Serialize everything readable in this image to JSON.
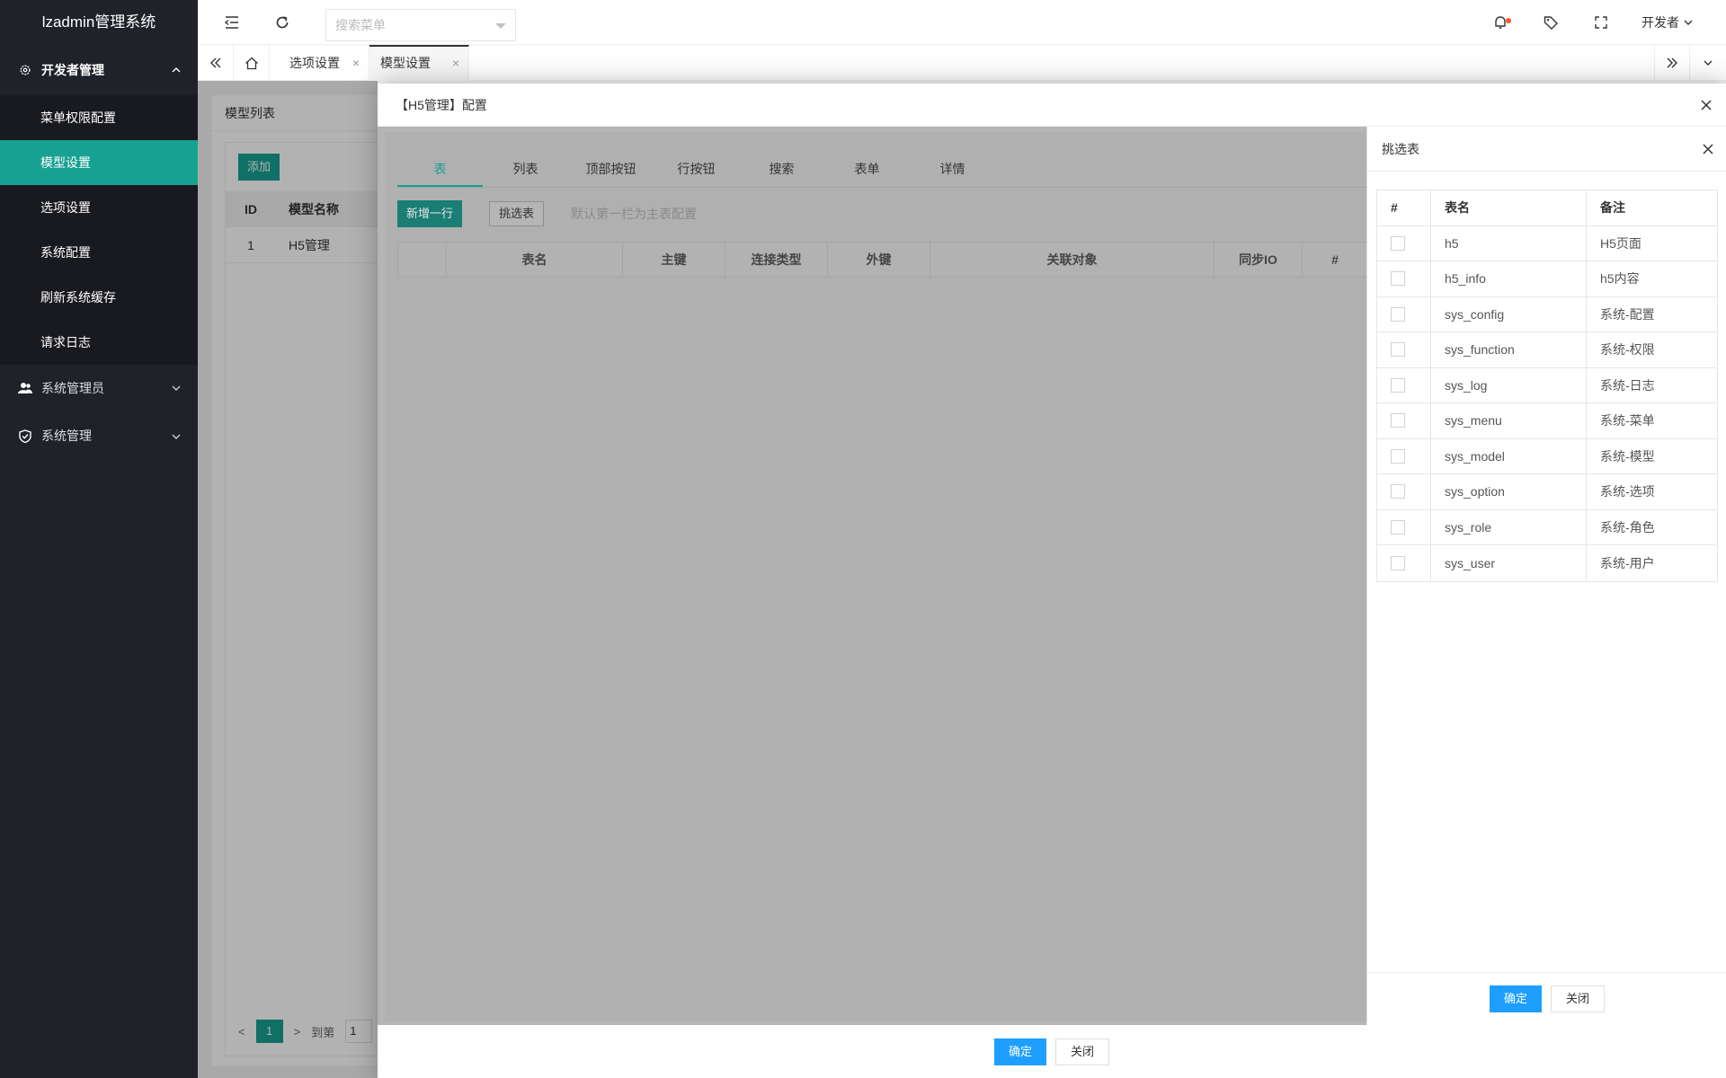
{
  "app": {
    "title": "lzadmin管理系统"
  },
  "sidebar": {
    "groups": [
      {
        "label": "开发者管理",
        "icon": "gear-icon",
        "expanded": true,
        "items": [
          "菜单权限配置",
          "模型设置",
          "选项设置",
          "系统配置",
          "刷新系统缓存",
          "请求日志"
        ],
        "active_item": "模型设置"
      },
      {
        "label": "系统管理员",
        "icon": "users-icon",
        "expanded": false
      },
      {
        "label": "系统管理",
        "icon": "shield-icon",
        "expanded": false
      }
    ]
  },
  "header": {
    "search_placeholder": "搜索菜单",
    "user": "开发者"
  },
  "tabs": [
    {
      "label": "选项设置"
    },
    {
      "label": "模型设置"
    }
  ],
  "page": {
    "card_title": "模型列表",
    "add_button": "添加",
    "columns": [
      "ID",
      "模型名称"
    ],
    "rows": [
      {
        "id": "1",
        "name": "H5管理"
      }
    ],
    "pager": {
      "current": "1",
      "goto_label": "到第",
      "goto_value": "1"
    }
  },
  "modal": {
    "title": "【H5管理】配置",
    "tabs": [
      "表",
      "列表",
      "顶部按钮",
      "行按钮",
      "搜索",
      "表单",
      "详情"
    ],
    "active_tab": "表",
    "add_row_button": "新增一行",
    "pick_table_button": "挑选表",
    "hint": "默认第一栏为主表配置",
    "columns": [
      "",
      "表名",
      "主键",
      "连接类型",
      "外键",
      "关联对象",
      "同步IO",
      "#"
    ],
    "confirm": "确定",
    "close": "关闭"
  },
  "picker": {
    "title": "挑选表",
    "columns": [
      "#",
      "表名",
      "备注"
    ],
    "rows": [
      {
        "name": "h5",
        "note": "H5页面"
      },
      {
        "name": "h5_info",
        "note": "h5内容"
      },
      {
        "name": "sys_config",
        "note": "系统-配置"
      },
      {
        "name": "sys_function",
        "note": "系统-权限"
      },
      {
        "name": "sys_log",
        "note": "系统-日志"
      },
      {
        "name": "sys_menu",
        "note": "系统-菜单"
      },
      {
        "name": "sys_model",
        "note": "系统-模型"
      },
      {
        "name": "sys_option",
        "note": "系统-选项"
      },
      {
        "name": "sys_role",
        "note": "系统-角色"
      },
      {
        "name": "sys_user",
        "note": "系统-用户"
      }
    ],
    "confirm": "确定",
    "close": "关闭"
  },
  "colors": {
    "accent": "#17a192",
    "primary": "#1e9fff",
    "sidebar_bg": "#20222a",
    "notify_dot": "#ff5722"
  }
}
